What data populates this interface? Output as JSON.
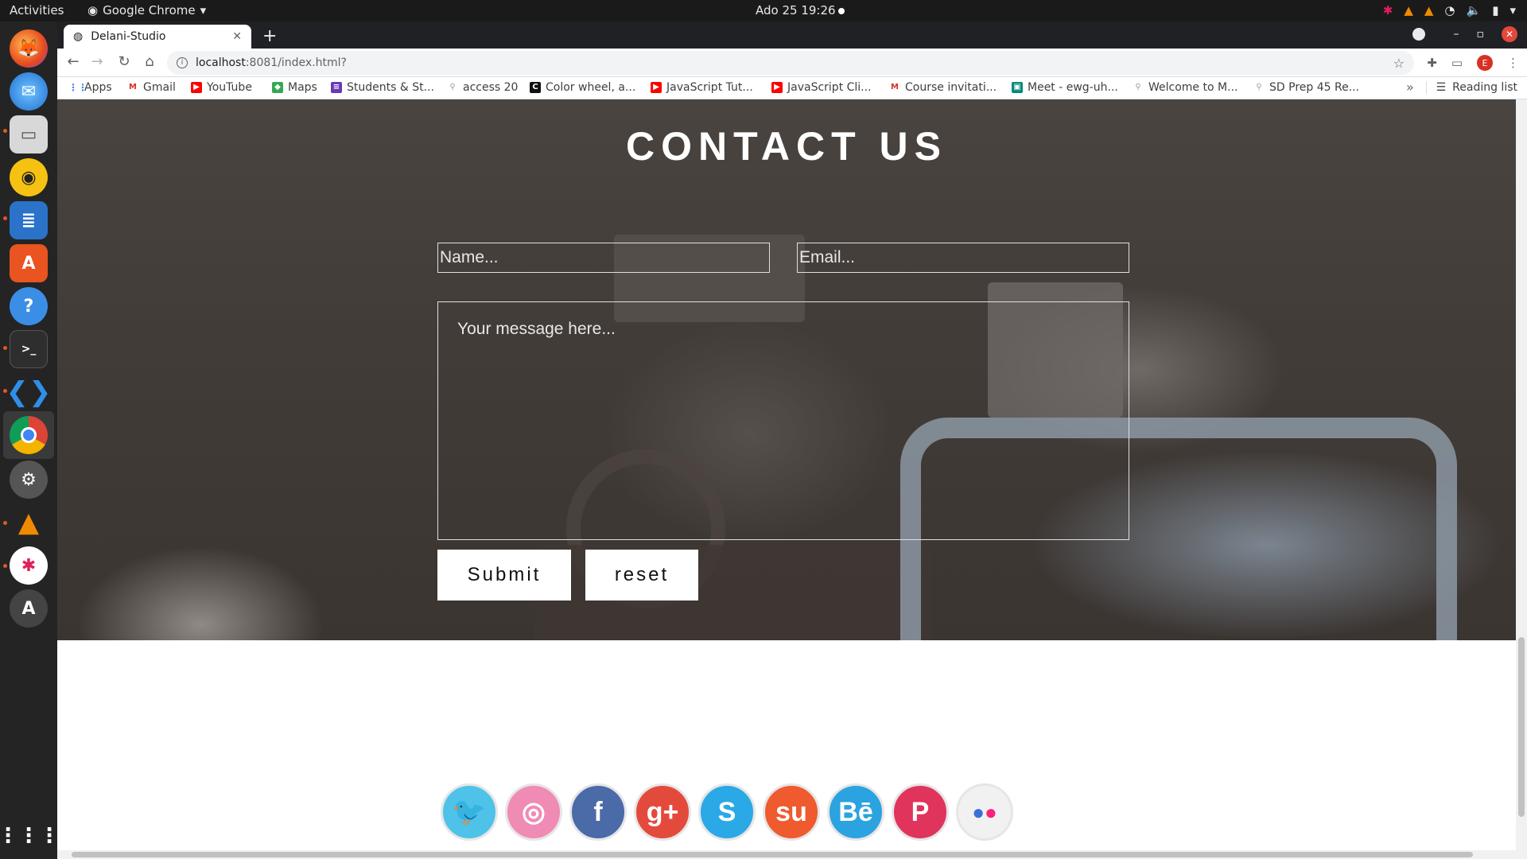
{
  "system": {
    "activities": "Activities",
    "app_name": "Google Chrome",
    "clock": "Ado 25  19:26"
  },
  "dock": {
    "apps": [
      "firefox-icon",
      "thunderbird-icon",
      "files-icon",
      "rhythmbox-icon",
      "writer-icon",
      "software-center-icon",
      "help-icon",
      "terminal-icon",
      "vscode-icon",
      "chrome-icon",
      "settings-icon",
      "vlc-icon",
      "slack-icon",
      "app-store-icon",
      "show-apps-icon"
    ]
  },
  "browser": {
    "tab_title": "Delani-Studio",
    "url_host": "localhost",
    "url_path": ":8081/index.html?",
    "profile_initial": "E",
    "bookmarks": [
      {
        "label": "Apps",
        "color": "#4285f4"
      },
      {
        "label": "Gmail",
        "color": "#d93025"
      },
      {
        "label": "YouTube",
        "color": "#ff0000"
      },
      {
        "label": "Maps",
        "color": "#34a853"
      },
      {
        "label": "Students & St...",
        "color": "#673ab7"
      },
      {
        "label": "access 20",
        "color": "#9e9e9e"
      },
      {
        "label": "Color wheel, a...",
        "color": "#111111"
      },
      {
        "label": "JavaScript Tut...",
        "color": "#ff0000"
      },
      {
        "label": "JavaScript Cli...",
        "color": "#ff0000"
      },
      {
        "label": "Course invitati...",
        "color": "#d93025"
      },
      {
        "label": "Meet - ewg-uh...",
        "color": "#00897b"
      },
      {
        "label": "Welcome to M...",
        "color": "#9e9e9e"
      },
      {
        "label": "SD Prep 45 Re...",
        "color": "#9e9e9e"
      }
    ],
    "reading_list": "Reading list"
  },
  "page": {
    "contact_title": "CONTACT US",
    "name_placeholder": "Name...",
    "email_placeholder": "Email...",
    "message_placeholder": "Your message here...",
    "submit_label": "Submit",
    "reset_label": "reset",
    "social": [
      {
        "name": "twitter-icon",
        "glyph": "🐦",
        "color": "#4ec2e8"
      },
      {
        "name": "dribbble-icon",
        "glyph": "◎",
        "color": "#f08bb5"
      },
      {
        "name": "facebook-icon",
        "glyph": "f",
        "color": "#4a6aa8"
      },
      {
        "name": "google-plus-icon",
        "glyph": "g+",
        "color": "#e44a3c"
      },
      {
        "name": "skype-icon",
        "glyph": "S",
        "color": "#2ba8e6"
      },
      {
        "name": "stumbleupon-icon",
        "glyph": "su",
        "color": "#ef5a2e"
      },
      {
        "name": "behance-icon",
        "glyph": "Bē",
        "color": "#2ba3e0"
      },
      {
        "name": "pinterest-icon",
        "glyph": "P",
        "color": "#e0345c"
      },
      {
        "name": "flickr-icon",
        "glyph": "●●",
        "color": "#f1f1f1"
      }
    ]
  }
}
